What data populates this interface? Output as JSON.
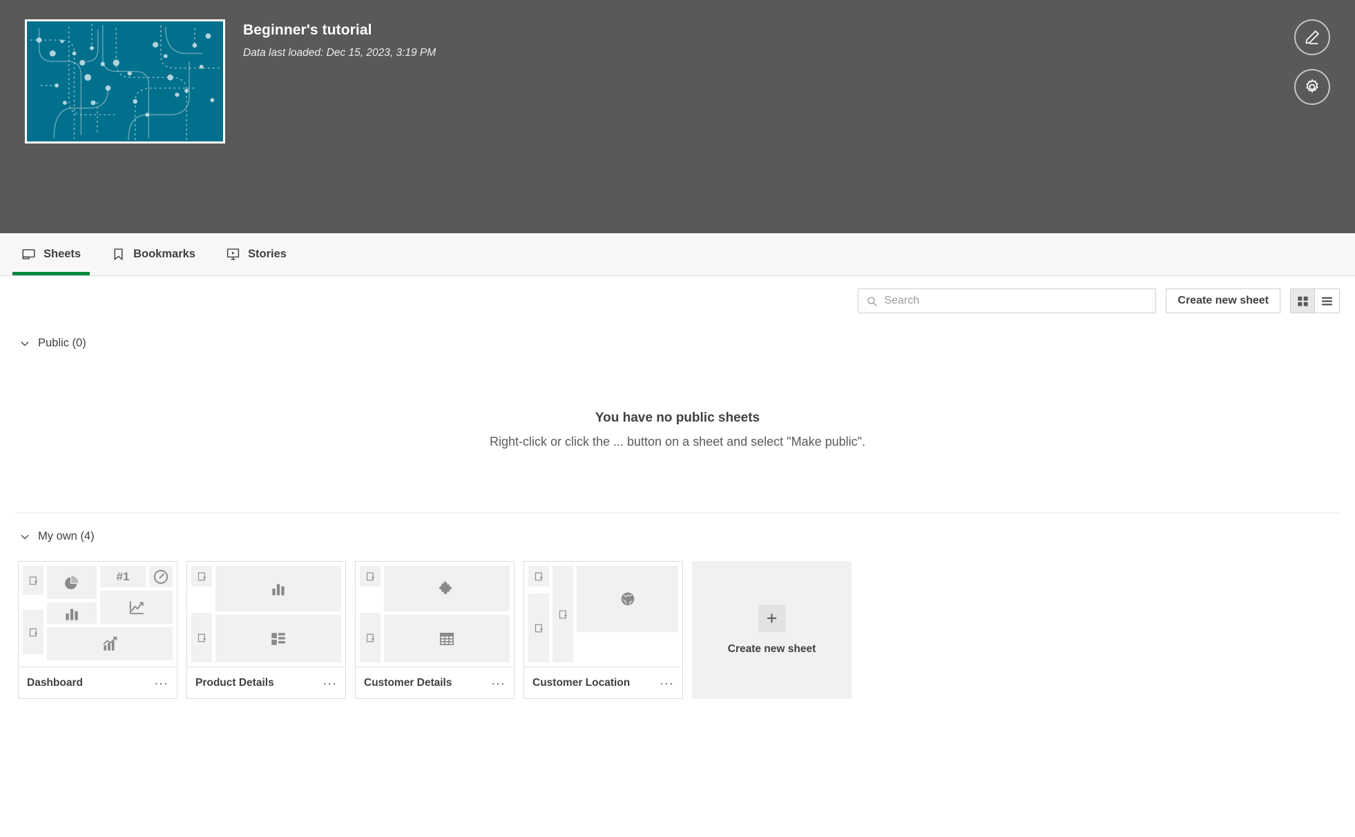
{
  "header": {
    "app_title": "Beginner's tutorial",
    "data_last_loaded": "Data last loaded: Dec 15, 2023, 3:19 PM",
    "thumbnail_bg": "#00708c",
    "background": "#595959",
    "actions": [
      {
        "name": "edit-app-button",
        "icon": "pencil-icon"
      },
      {
        "name": "app-settings-button",
        "icon": "gear-icon"
      }
    ]
  },
  "tabs": [
    {
      "label": "Sheets",
      "icon": "sheet-icon",
      "active": true
    },
    {
      "label": "Bookmarks",
      "icon": "bookmark-icon",
      "active": false
    },
    {
      "label": "Stories",
      "icon": "story-icon",
      "active": false
    }
  ],
  "accent_color": "#00873d",
  "toolbar": {
    "search_placeholder": "Search",
    "search_value": "",
    "create_sheet_label": "Create new sheet",
    "grid_view_active": true,
    "list_view_active": false
  },
  "sections": {
    "public": {
      "title": "Public (0)",
      "expanded": true,
      "empty_title": "You have no public sheets",
      "empty_subtitle": "Right-click or click the ... button on a sheet and select \"Make public\"."
    },
    "my_own": {
      "title": "My own (4)",
      "expanded": true,
      "sheets": [
        {
          "name": "Dashboard",
          "menu_label": "...",
          "layout": "dashboard",
          "objects": [
            "filter-pane",
            "filter-pane",
            "pie-chart",
            "kpi",
            "gauge",
            "bar-chart",
            "line-chart",
            "combo-chart"
          ],
          "kpi_text": "#1"
        },
        {
          "name": "Product Details",
          "menu_label": "...",
          "layout": "two-rows",
          "objects": [
            "filter-pane",
            "bar-chart",
            "filter-pane",
            "treemap"
          ]
        },
        {
          "name": "Customer Details",
          "menu_label": "...",
          "layout": "two-rows",
          "objects": [
            "filter-pane",
            "extension",
            "filter-pane",
            "table"
          ]
        },
        {
          "name": "Customer Location",
          "menu_label": "...",
          "layout": "map",
          "objects": [
            "filter-pane",
            "filter-pane",
            "filter-pane",
            "map"
          ]
        }
      ],
      "create_card": {
        "label": "Create new sheet",
        "plus": "+"
      }
    }
  }
}
